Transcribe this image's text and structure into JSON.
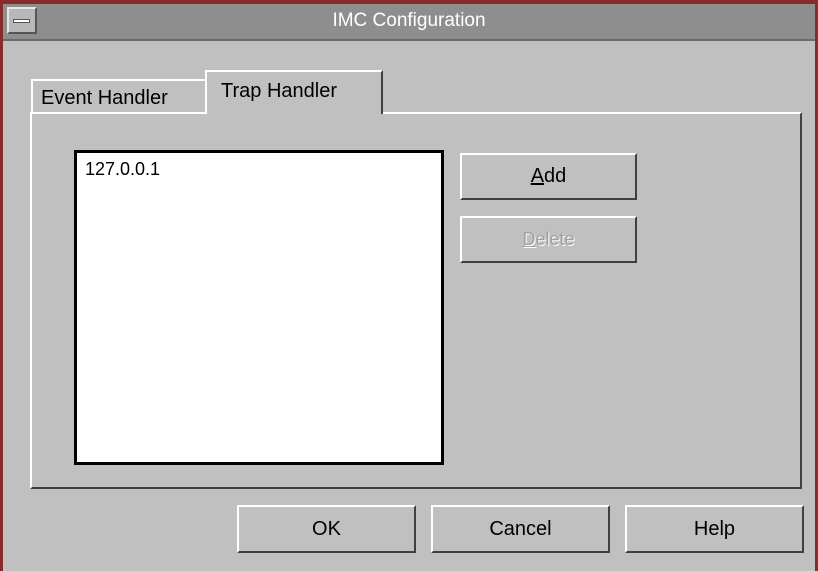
{
  "window": {
    "title": "IMC Configuration"
  },
  "tabs": [
    {
      "label": "Event Handler",
      "active": false
    },
    {
      "label": "Trap Handler",
      "active": true
    }
  ],
  "trap_handler": {
    "addresses": [
      "127.0.0.1"
    ],
    "add_button": {
      "mnemonic": "A",
      "rest": "dd",
      "enabled": true
    },
    "delete_button": {
      "mnemonic": "D",
      "rest": "elete",
      "enabled": false
    }
  },
  "footer": {
    "ok_label": "OK",
    "cancel_label": "Cancel",
    "help_label": "Help"
  },
  "colors": {
    "title_bar": "#8e8e8e",
    "window_border": "#8a2a2a",
    "face": "#c0c0c0"
  }
}
